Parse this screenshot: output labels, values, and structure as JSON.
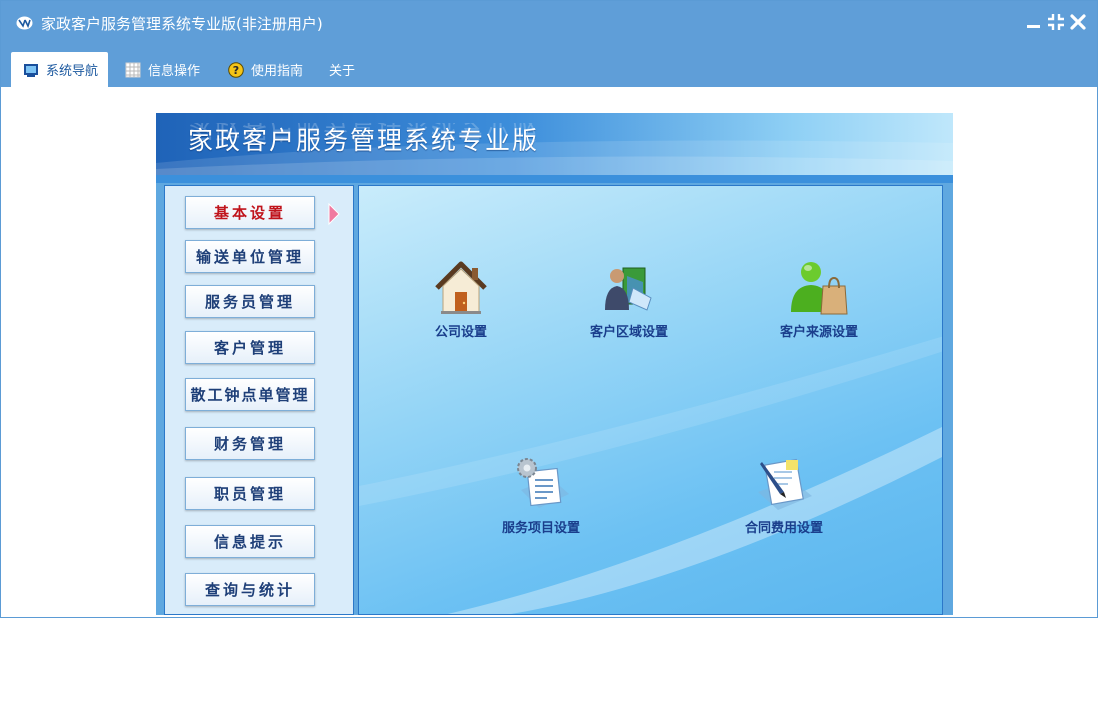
{
  "window": {
    "title": "家政客户服务管理系统专业版(非注册用户)"
  },
  "tabs": [
    {
      "label": "系统导航",
      "icon": "monitor-icon",
      "active": true
    },
    {
      "label": "信息操作",
      "icon": "grid-icon",
      "active": false
    },
    {
      "label": "使用指南",
      "icon": "help-icon",
      "active": false
    },
    {
      "label": "关于",
      "icon": "",
      "active": false
    }
  ],
  "banner": {
    "title": "家政客户服务管理系统专业版"
  },
  "sidebar": {
    "items": [
      {
        "label": "基本设置",
        "active": true
      },
      {
        "label": "输送单位管理",
        "active": false
      },
      {
        "label": "服务员管理",
        "active": false
      },
      {
        "label": "客户管理",
        "active": false
      },
      {
        "label": "散工钟点单管理",
        "active": false
      },
      {
        "label": "财务管理",
        "active": false
      },
      {
        "label": "职员管理",
        "active": false
      },
      {
        "label": "信息提示",
        "active": false
      },
      {
        "label": "查询与统计",
        "active": false
      }
    ]
  },
  "main": {
    "items": [
      {
        "label": "公司设置",
        "icon": "house-icon"
      },
      {
        "label": "客户区域设置",
        "icon": "person-book-icon"
      },
      {
        "label": "客户来源设置",
        "icon": "user-bag-icon"
      },
      {
        "label": "服务项目设置",
        "icon": "gear-document-icon"
      },
      {
        "label": "合同费用设置",
        "icon": "pen-document-icon"
      }
    ]
  },
  "colors": {
    "titlebar": "#5f9ed8",
    "active_menu_text": "#c0141c",
    "menu_text": "#1e3f78",
    "item_label": "#1a3e8c"
  }
}
